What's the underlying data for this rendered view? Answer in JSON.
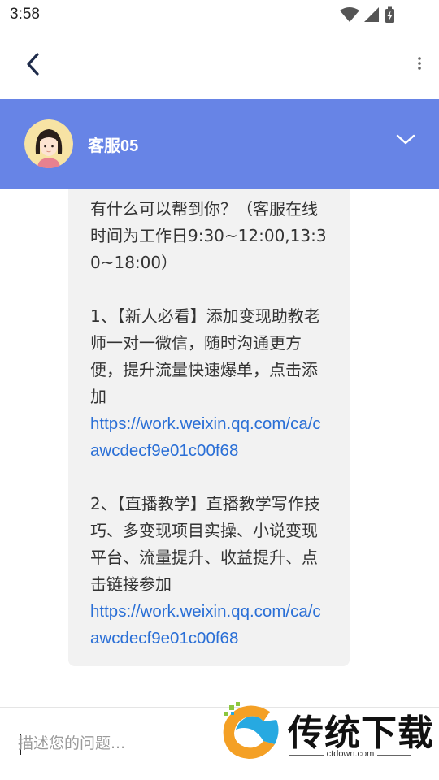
{
  "status": {
    "time": "3:58"
  },
  "header": {
    "agent_name": "客服05"
  },
  "message": {
    "intro": "有什么可以帮到你？（客服在线时间为工作日9:30~12:00,13:30~18:00）",
    "item1_text": "1、【新人必看】添加变现助教老师一对一微信，随时沟通更方便，提升流量快速爆单，点击添加",
    "item1_link": "https://work.weixin.qq.com/ca/cawcdecf9e01c00f68",
    "item2_text": "2、【直播教学】直播教学写作技巧、多变现项目实操、小说变现平台、流量提升、收益提升、点击链接参加",
    "item2_link": "https://work.weixin.qq.com/ca/cawcdecf9e01c00f68"
  },
  "input": {
    "placeholder": "描述您的问题..."
  },
  "watermark": {
    "title": "传统下载",
    "subtitle": "ctdown.com"
  },
  "colors": {
    "header_bg": "#6784e6",
    "link": "#2a6fd6",
    "bubble_bg": "#f2f2f2"
  },
  "icons": [
    "wifi-icon",
    "signal-icon",
    "battery-icon",
    "back-arrow-icon",
    "more-vertical-icon",
    "chevron-down-icon",
    "avatar"
  ]
}
